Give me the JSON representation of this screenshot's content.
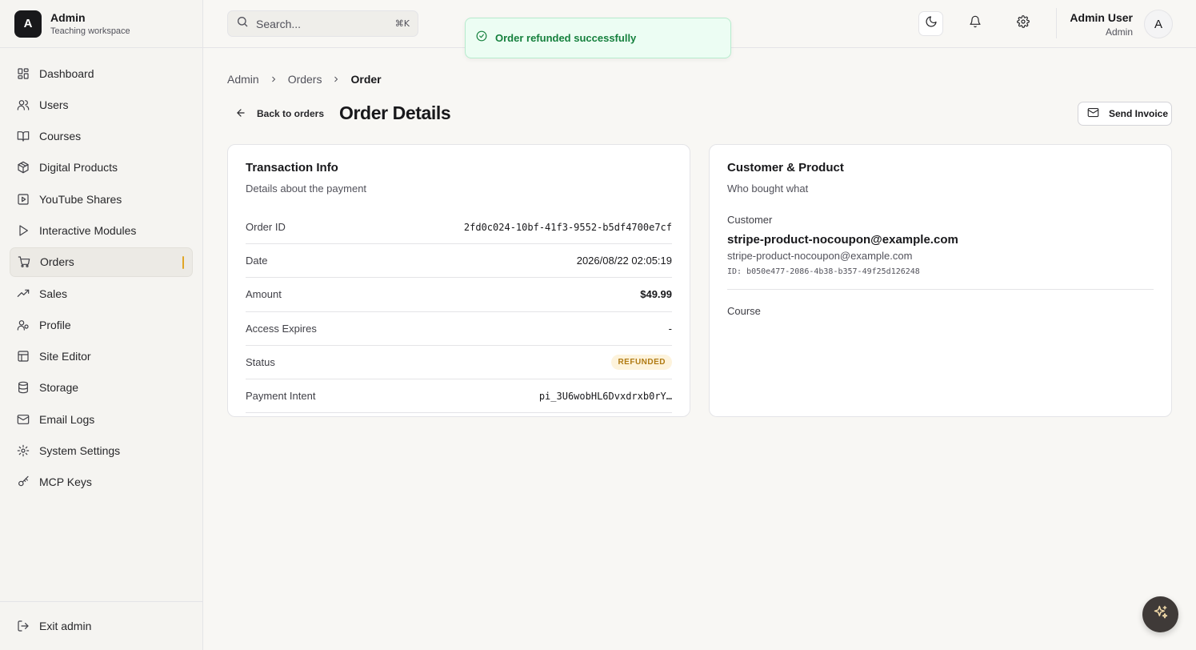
{
  "brand": {
    "logo_letter": "A",
    "name": "Admin",
    "subtitle": "Teaching workspace"
  },
  "sidebar": {
    "items": [
      {
        "label": "Dashboard",
        "icon": "dashboard-icon"
      },
      {
        "label": "Users",
        "icon": "users-icon"
      },
      {
        "label": "Courses",
        "icon": "book-icon"
      },
      {
        "label": "Digital Products",
        "icon": "package-icon"
      },
      {
        "label": "YouTube Shares",
        "icon": "play-square-icon"
      },
      {
        "label": "Interactive Modules",
        "icon": "play-icon"
      },
      {
        "label": "Orders",
        "icon": "cart-icon",
        "active": true
      },
      {
        "label": "Sales",
        "icon": "trending-up-icon"
      },
      {
        "label": "Profile",
        "icon": "profile-icon"
      },
      {
        "label": "Site Editor",
        "icon": "layout-icon"
      },
      {
        "label": "Storage",
        "icon": "database-icon"
      },
      {
        "label": "Email Logs",
        "icon": "mail-icon"
      },
      {
        "label": "System Settings",
        "icon": "gear-icon"
      },
      {
        "label": "MCP Keys",
        "icon": "key-icon"
      }
    ],
    "footer_label": "Exit admin"
  },
  "header": {
    "search_placeholder": "Search...",
    "search_shortcut": "⌘K",
    "user_name": "Admin User",
    "user_role": "Admin",
    "avatar_letter": "A"
  },
  "toast": {
    "message": "Order refunded successfully"
  },
  "breadcrumb": [
    "Admin",
    "Orders",
    "Order"
  ],
  "page": {
    "back_label": "Back to orders",
    "title": "Order Details",
    "send_invoice_label": "Send Invoice"
  },
  "transaction": {
    "title": "Transaction Info",
    "description": "Details about the payment",
    "rows": [
      {
        "label": "Order ID",
        "value": "2fd0c024-10bf-41f3-9552-b5df4700e7cf"
      },
      {
        "label": "Date",
        "value": "2026/08/22 02:05:19"
      },
      {
        "label": "Amount",
        "value": "$49.99"
      },
      {
        "label": "Access Expires",
        "value": "-"
      },
      {
        "label": "Status",
        "value": "REFUNDED"
      },
      {
        "label": "Payment Intent",
        "value": "pi_3U6wobHL6Dvxdrxb0rY…"
      }
    ]
  },
  "customer": {
    "title": "Customer & Product",
    "description": "Who bought what",
    "customer_label": "Customer",
    "name": "stripe-product-nocoupon@example.com",
    "email": "stripe-product-nocoupon@example.com",
    "id_text": "ID: b050e477-2086-4b38-b357-49f25d126248",
    "course_label": "Course"
  },
  "colors": {
    "accent": "#e0a526",
    "toast_text": "#15803d",
    "badge_text": "#b07a12",
    "badge_bg": "#fdf3dc"
  }
}
